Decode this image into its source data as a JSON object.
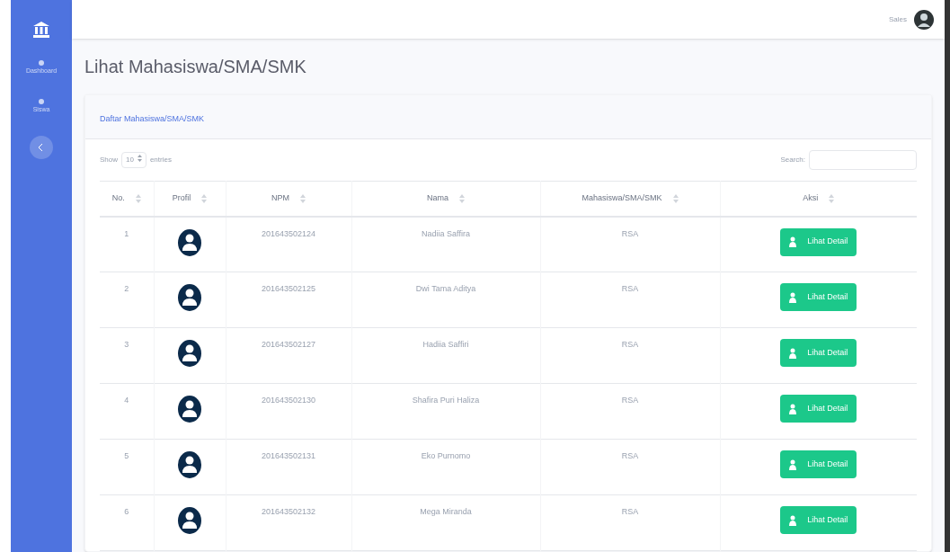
{
  "sidebar": {
    "items": [
      {
        "label": "Dashboard",
        "selected": false
      },
      {
        "label": "Siswa",
        "selected": false
      }
    ]
  },
  "topbar": {
    "user_name": "Sales"
  },
  "page_title": "Lihat Mahasiswa/SMA/SMK",
  "card": {
    "title": "Daftar Mahasiswa/SMA/SMK",
    "length": {
      "prefix": "Show",
      "value": "10",
      "suffix": "entries"
    },
    "search_label": "Search:",
    "table": {
      "columns": [
        "No.",
        "Profil",
        "NPM",
        "Nama",
        "Mahasiswa/SMA/SMK",
        "Aksi"
      ],
      "rows": [
        {
          "no": "1",
          "npm": "201643502124",
          "nama": "Nadiia Saffira",
          "jenis": "RSA",
          "action": "Lihat Detail"
        },
        {
          "no": "2",
          "npm": "201643502125",
          "nama": "Dwi Tama Aditya",
          "jenis": "RSA",
          "action": "Lihat Detail"
        },
        {
          "no": "3",
          "npm": "201643502127",
          "nama": "Hadiia Saffiri",
          "jenis": "RSA",
          "action": "Lihat Detail"
        },
        {
          "no": "4",
          "npm": "201643502130",
          "nama": "Shafira Puri Haliza",
          "jenis": "RSA",
          "action": "Lihat Detail"
        },
        {
          "no": "5",
          "npm": "201643502131",
          "nama": "Eko Purnomo",
          "jenis": "RSA",
          "action": "Lihat Detail"
        },
        {
          "no": "6",
          "npm": "201643502132",
          "nama": "Mega Miranda",
          "jenis": "RSA",
          "action": "Lihat Detail"
        }
      ]
    }
  }
}
